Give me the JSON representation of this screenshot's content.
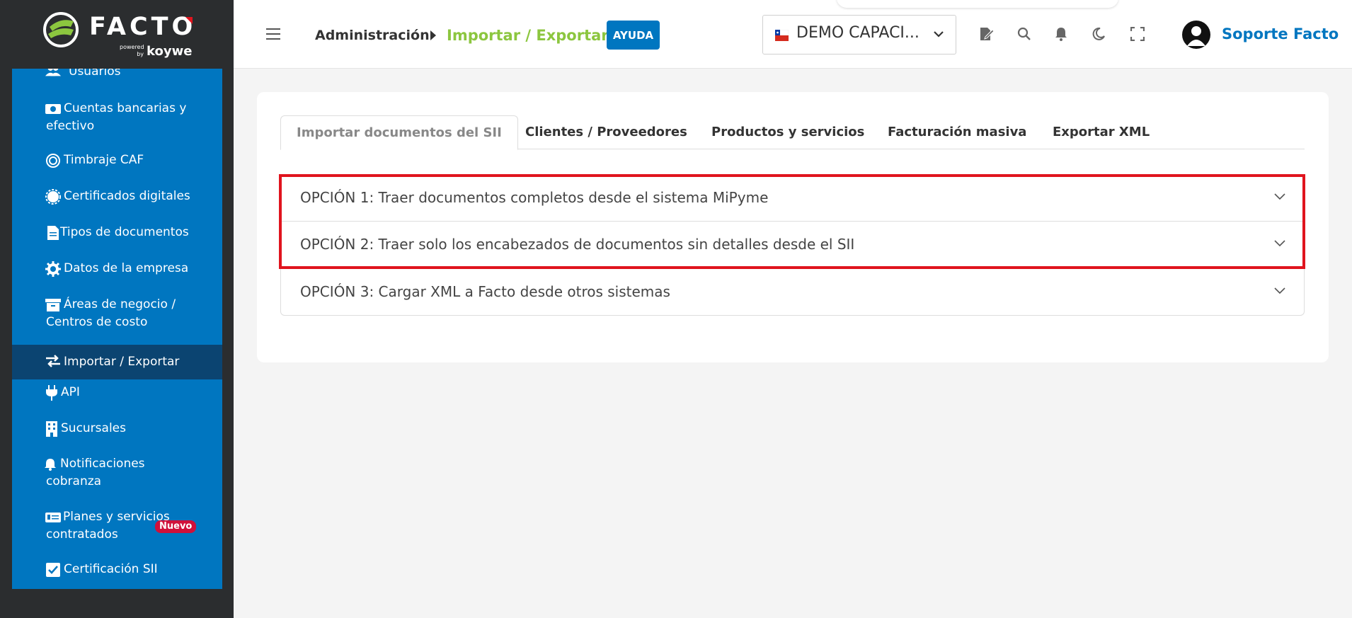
{
  "brand": {
    "logo_text": "FACTO",
    "powered": "powered by",
    "koywe": "koywe"
  },
  "sidebar": {
    "items": [
      {
        "label": "Usuarios",
        "icon": "users-icon"
      },
      {
        "label": "Cuentas bancarias y efectivo",
        "icon": "money-icon"
      },
      {
        "label": "Timbraje CAF",
        "icon": "stamp-icon"
      },
      {
        "label": "Certificados digitales",
        "icon": "certificate-icon"
      },
      {
        "label": "Tipos de documentos",
        "icon": "document-icon"
      },
      {
        "label": "Datos de la empresa",
        "icon": "gear-icon"
      },
      {
        "label": "Áreas de negocio / Centros de costo",
        "icon": "archive-icon"
      },
      {
        "label": "Importar / Exportar",
        "icon": "exchange-icon",
        "active": true
      },
      {
        "label": "API",
        "icon": "plug-icon"
      },
      {
        "label": "Sucursales",
        "icon": "building-icon"
      },
      {
        "label": "Notificaciones cobranza",
        "icon": "bell-icon"
      },
      {
        "label": "Planes y servicios contratados",
        "icon": "plan-icon",
        "badge": "Nuevo"
      },
      {
        "label": "Certificación SII",
        "icon": "check-square-icon"
      }
    ]
  },
  "header": {
    "breadcrumb_parent": "Administración",
    "breadcrumb_current": "Importar / Exportar",
    "help_label": "AYUDA",
    "company": "DEMO CAPACI...",
    "user_name": "Soporte Facto"
  },
  "tabs": [
    {
      "label": "Importar documentos del SII",
      "active": true
    },
    {
      "label": "Clientes / Proveedores"
    },
    {
      "label": "Productos y servicios"
    },
    {
      "label": "Facturación masiva"
    },
    {
      "label": "Exportar XML"
    }
  ],
  "accordion": [
    {
      "label": "OPCIÓN 1: Traer documentos completos desde el sistema MiPyme"
    },
    {
      "label": "OPCIÓN 2: Traer solo los encabezados de documentos sin detalles desde el SII"
    },
    {
      "label": "OPCIÓN 3: Cargar XML a Facto desde otros sistemas"
    }
  ],
  "colors": {
    "primary": "#0076c0",
    "accent_green": "#8cc63f",
    "sidebar_bg": "#2b2d2f",
    "active_item": "#0b4471",
    "badge_red": "#d0103a",
    "highlight_red": "#e0141e"
  }
}
